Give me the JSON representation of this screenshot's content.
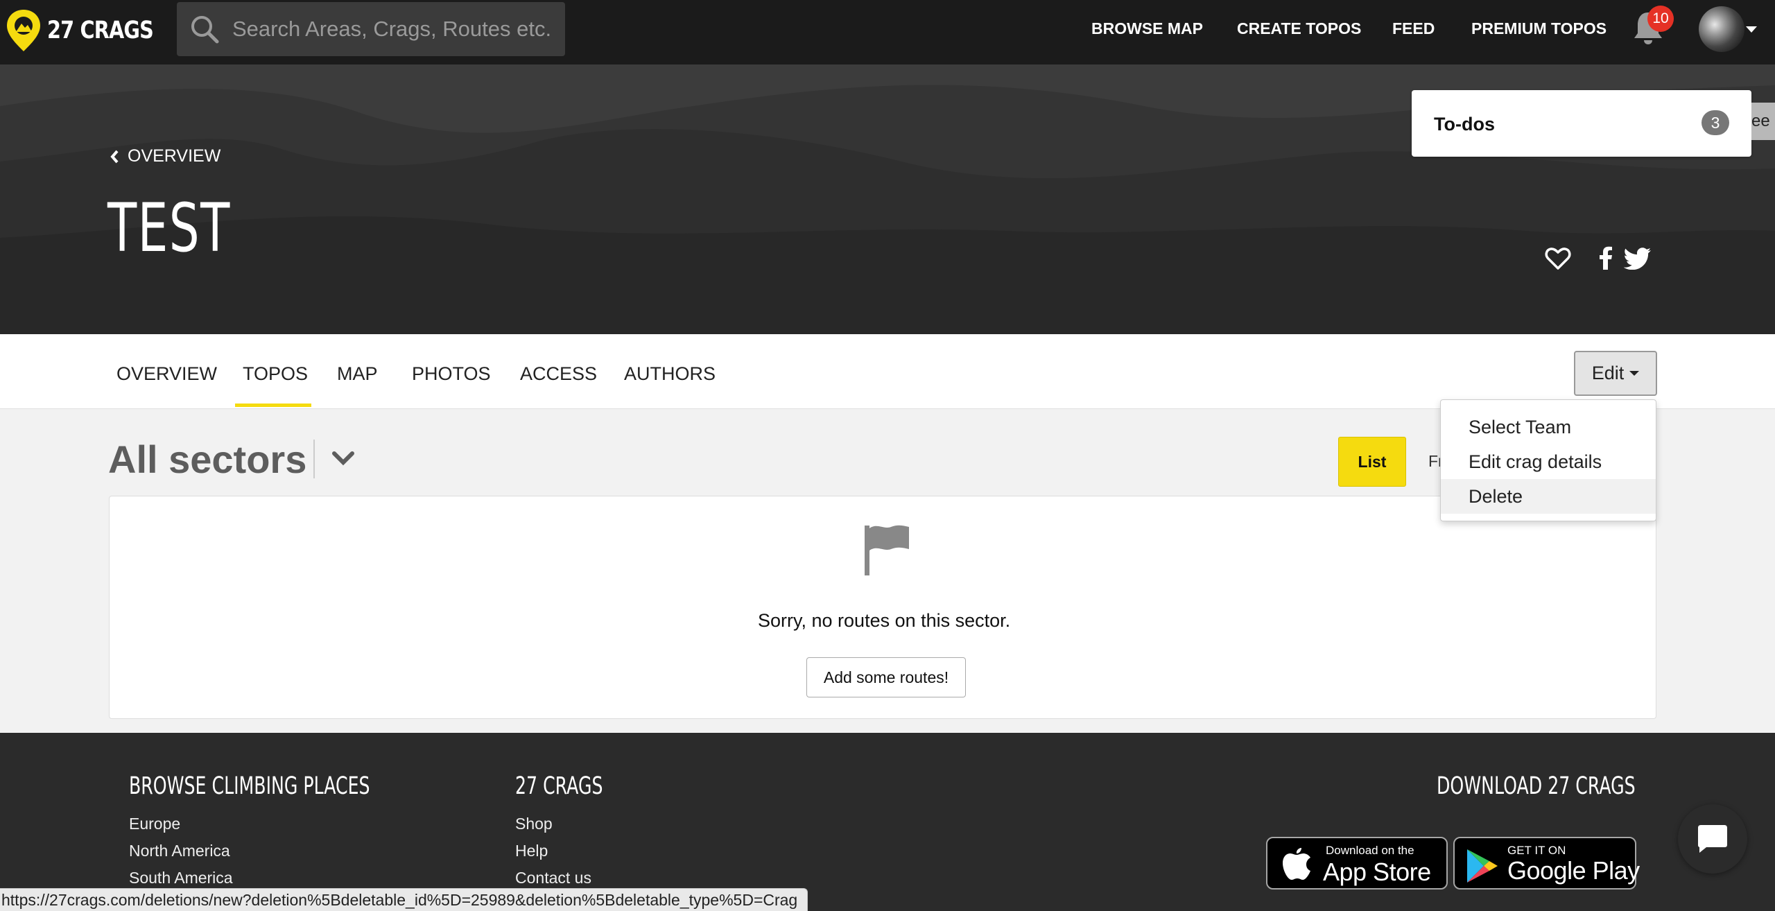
{
  "brand": {
    "name": "27 CRAGS",
    "accent_color": "#f5db0f"
  },
  "search": {
    "placeholder": "Search Areas, Crags, Routes etc."
  },
  "nav": {
    "links": [
      "BROWSE MAP",
      "CREATE TOPOS",
      "FEED",
      "PREMIUM TOPOS"
    ],
    "notification_count": "10"
  },
  "hero": {
    "back_label": "OVERVIEW",
    "title": "TEST"
  },
  "todo": {
    "label": "To-dos",
    "count": "3",
    "tab_text": "ee"
  },
  "tabs": {
    "items": [
      "OVERVIEW",
      "TOPOS",
      "MAP",
      "PHOTOS",
      "ACCESS",
      "AUTHORS"
    ],
    "active": "TOPOS",
    "edit_label": "Edit"
  },
  "edit_menu": {
    "items": [
      "Select Team",
      "Edit crag details",
      "Delete"
    ],
    "hovered": "Delete"
  },
  "sectors": {
    "title": "All sectors",
    "list_label": "List",
    "other_view_label": "Fr",
    "empty_message": "Sorry, no routes on this sector.",
    "add_button": "Add some routes!"
  },
  "footer": {
    "browse": {
      "heading": "BROWSE CLIMBING PLACES",
      "links": [
        "Europe",
        "North America",
        "South America"
      ]
    },
    "company": {
      "heading": "27 CRAGS",
      "links": [
        "Shop",
        "Help",
        "Contact us"
      ]
    },
    "download": {
      "heading": "DOWNLOAD 27 CRAGS",
      "app_store_small": "Download on the",
      "app_store_big": "App Store",
      "google_small": "GET IT ON",
      "google_big": "Google Play"
    }
  },
  "status_bar_url": "https://27crags.com/deletions/new?deletion%5Bdeletable_id%5D=25989&deletion%5Bdeletable_type%5D=Crag"
}
